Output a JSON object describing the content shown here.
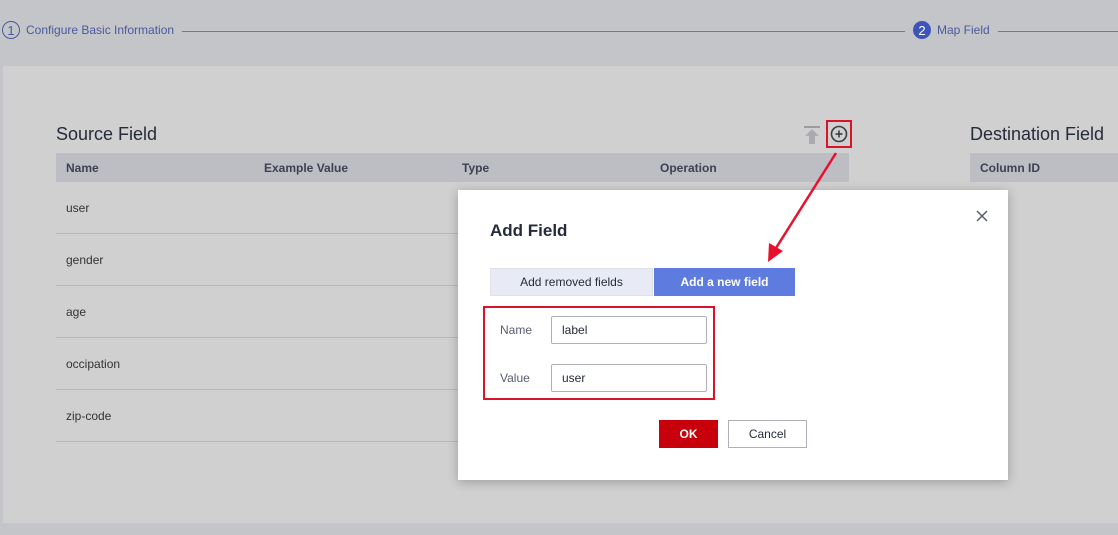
{
  "stepper": {
    "steps": [
      {
        "number": "1",
        "label": "Configure Basic Information"
      },
      {
        "number": "2",
        "label": "Map Field"
      }
    ]
  },
  "source": {
    "title": "Source Field",
    "columns": [
      "Name",
      "Example Value",
      "Type",
      "Operation"
    ],
    "rows": [
      {
        "name": "user"
      },
      {
        "name": "gender"
      },
      {
        "name": "age"
      },
      {
        "name": "occipation"
      },
      {
        "name": "zip-code"
      }
    ]
  },
  "destination": {
    "title": "Destination Field",
    "columns": [
      "Column ID"
    ]
  },
  "toolbar": {
    "upload_icon": "upload-icon",
    "add_icon": "add-circle-icon"
  },
  "modal": {
    "title": "Add Field",
    "tabs": [
      "Add removed fields",
      "Add a new field"
    ],
    "name_label": "Name",
    "name_value": "label",
    "value_label": "Value",
    "value_value": "user",
    "ok_label": "OK",
    "cancel_label": "Cancel"
  },
  "colors": {
    "primary": "#5e7ce0",
    "ok_button": "#c7000b",
    "highlight": "#d8132a",
    "step_active": "#3d55b8"
  }
}
